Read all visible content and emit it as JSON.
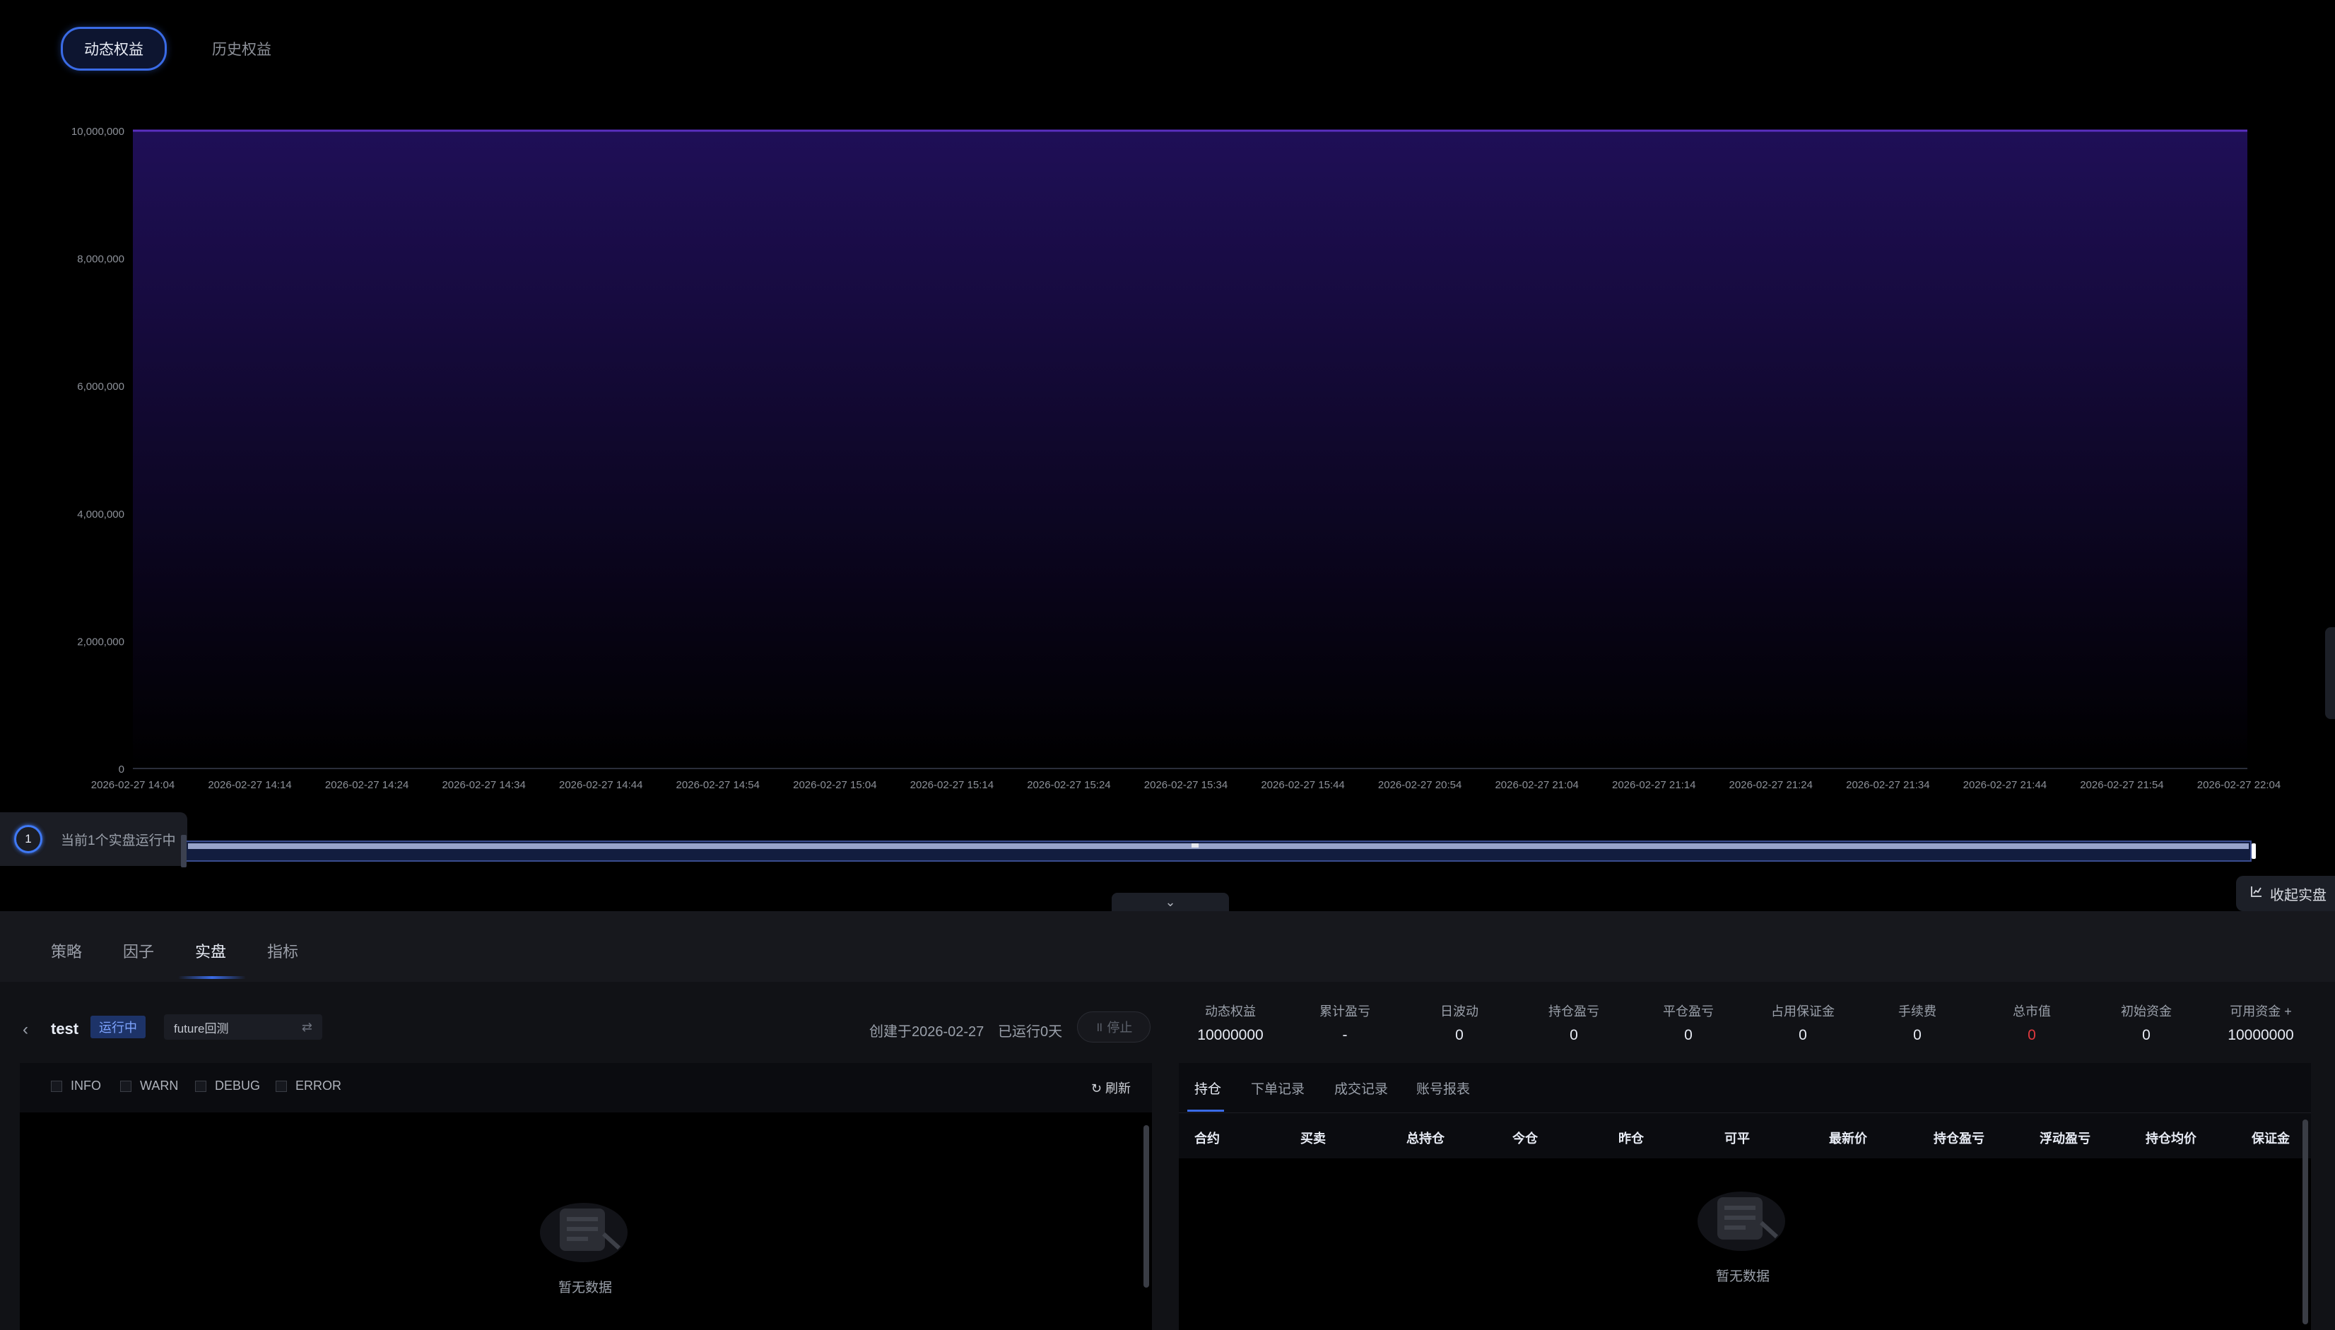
{
  "top_tabs": {
    "dynamic_equity": "动态权益",
    "historical_equity": "历史权益"
  },
  "chart_data": {
    "type": "area",
    "x": [
      "2026-02-27 14:04",
      "2026-02-27 14:14",
      "2026-02-27 14:24",
      "2026-02-27 14:34",
      "2026-02-27 14:44",
      "2026-02-27 14:54",
      "2026-02-27 15:04",
      "2026-02-27 15:14",
      "2026-02-27 15:24",
      "2026-02-27 15:34",
      "2026-02-27 15:44",
      "2026-02-27 20:54",
      "2026-02-27 21:04",
      "2026-02-27 21:14",
      "2026-02-27 21:24",
      "2026-02-27 21:34",
      "2026-02-27 21:44",
      "2026-02-27 21:54",
      "2026-02-27 22:04"
    ],
    "series": [
      {
        "values": [
          10000000,
          10000000,
          10000000,
          10000000,
          10000000,
          10000000,
          10000000,
          10000000,
          10000000,
          10000000,
          10000000,
          10000000,
          10000000,
          10000000,
          10000000,
          10000000,
          10000000,
          10000000,
          10000000
        ]
      }
    ],
    "y_ticks": [
      "0",
      "2,000,000",
      "4,000,000",
      "6,000,000",
      "8,000,000",
      "10,000,000"
    ],
    "ylim": [
      0,
      10000000
    ],
    "grid": true,
    "colors": {
      "line": "#5a2fbf",
      "fill_top": "#1f0f57",
      "fill_bottom": "#000000"
    }
  },
  "running_badge": {
    "count": "1",
    "text": "当前1个实盘运行中"
  },
  "collapse_panel": {
    "label": "收起实盘"
  },
  "bottom_nav": {
    "strategy": "策略",
    "factor": "因子",
    "live": "实盘",
    "indicator": "指标"
  },
  "strategy": {
    "name": "test",
    "status": "运行中",
    "mode": "future回测",
    "created": "创建于2026-02-27",
    "elapsed": "已运行0天",
    "stop": "停止"
  },
  "stats": [
    {
      "label": "动态权益",
      "value": "10000000"
    },
    {
      "label": "累计盈亏",
      "value": "-"
    },
    {
      "label": "日波动",
      "value": "0"
    },
    {
      "label": "持仓盈亏",
      "value": "0"
    },
    {
      "label": "平仓盈亏",
      "value": "0"
    },
    {
      "label": "占用保证金",
      "value": "0"
    },
    {
      "label": "手续费",
      "value": "0"
    },
    {
      "label": "总市值",
      "value": "0"
    },
    {
      "label": "初始资金",
      "value": "0"
    },
    {
      "label": "可用资金",
      "value": "10000000"
    }
  ],
  "log": {
    "levels": [
      "INFO",
      "WARN",
      "DEBUG",
      "ERROR"
    ],
    "refresh": "刷新",
    "empty": "暂无数据"
  },
  "positions": {
    "tabs": [
      "持仓",
      "下单记录",
      "成交记录",
      "账号报表"
    ],
    "columns": [
      "合约",
      "买卖",
      "总持仓",
      "今仓",
      "昨仓",
      "可平",
      "最新价",
      "持仓盈亏",
      "浮动盈亏",
      "持仓均价",
      "保证金"
    ],
    "empty": "暂无数据"
  },
  "colors": {
    "accent": "#3a6be6",
    "negative": "#e0393e"
  }
}
